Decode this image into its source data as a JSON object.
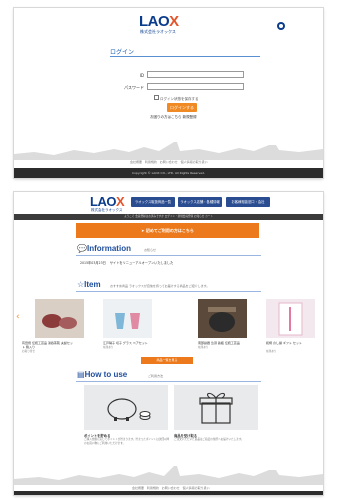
{
  "login_page": {
    "logo": {
      "text_main": "LAO",
      "text_x": "X",
      "subtitle": "株式会社ラオックス"
    },
    "title": "ログイン",
    "fields": [
      {
        "label": "ID",
        "value": "",
        "placeholder": ""
      },
      {
        "label": "パスワード",
        "value": "",
        "placeholder": ""
      }
    ],
    "remember_label": "ログイン状態を保存する",
    "login_button": "ログインする",
    "help_text": "お困りの方はこちら 新規登録",
    "footer_links": [
      "会社概要",
      "利用規約",
      "お問い合わせ",
      "個人情報の取り扱い"
    ],
    "copyright": "Copyright © LAOX CO., LTD. All Rights Reserved."
  },
  "top_page": {
    "logo": {
      "text_main": "LAO",
      "text_x": "X",
      "subtitle": "株式会社ラオックス"
    },
    "header_buttons": [
      "ラオックス取扱商品一覧",
      "ラオックス店舗・各種情報",
      "お客様相談窓口・会社"
    ],
    "strip_text": "ようこそ 会員登録はお済みですか ログイン・新規会員登録 お知らせ カート",
    "banner_text": "初めてご利用の方はこちら",
    "information": {
      "title": "Information",
      "subtitle": "お知らせ",
      "items": [
        {
          "date": "2015年03月23日",
          "text": "サイトをリニューアルオープンいたしました"
        }
      ]
    },
    "item": {
      "title": "Item",
      "subtitle": "おすすめ商品 ラオックスが自信を持ってお届けする商品をご紹介します。",
      "cards": [
        {
          "title": "有田焼 伝統工芸品 湯呑茶碗 夫婦セット 箱入り",
          "sub": "お取り寄せ"
        },
        {
          "title": "江戸硝子 切子 グラス ペアセット",
          "sub": "在庫あり"
        },
        {
          "title": "南部鉄器 急須 鉄瓶 伝統工芸品",
          "sub": "在庫あり"
        },
        {
          "title": "和柄 のし袋 ギフト セット",
          "sub": "在庫あり"
        }
      ],
      "more_button": "商品一覧を見る"
    },
    "how_to_use": {
      "title": "How to use",
      "subtitle": "ご利用方法",
      "steps": [
        {
          "title": "ポイントを貯める",
          "text": "ご購入金額に応じてポイントが貯まります。貯まったポイントは次回以降のお買い物にご利用いただけます。"
        },
        {
          "title": "商品を受け取る",
          "text": "ご注文いただいた商品はご指定の住所へお届けいたします。"
        }
      ]
    },
    "footer_links": [
      "会社概要",
      "利用規約",
      "お問い合わせ",
      "個人情報の取り扱い"
    ]
  },
  "colors": {
    "brand_blue": "#0b3c8c",
    "accent_orange": "#ec7a1c",
    "nav_blue": "#2a4d92"
  }
}
